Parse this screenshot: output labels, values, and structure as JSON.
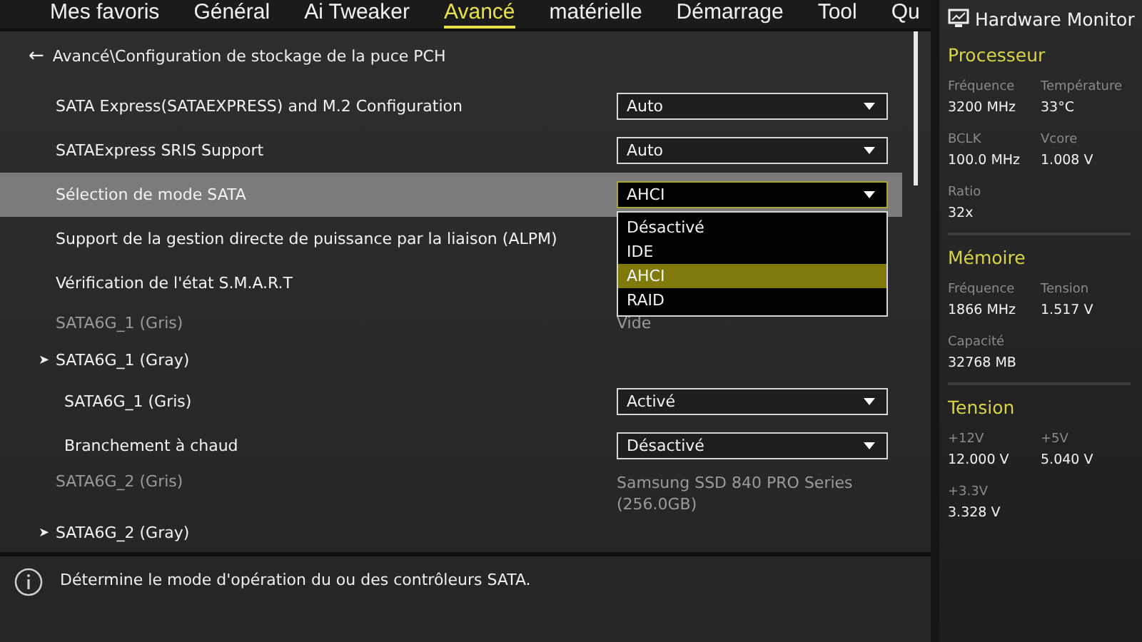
{
  "tabs": [
    {
      "label": "Mes favoris",
      "selected": false
    },
    {
      "label": "Général",
      "selected": false
    },
    {
      "label": "Ai Tweaker",
      "selected": false
    },
    {
      "label": "Avancé",
      "selected": true
    },
    {
      "label": "matérielle",
      "selected": false
    },
    {
      "label": "Démarrage",
      "selected": false
    },
    {
      "label": "Tool",
      "selected": false
    },
    {
      "label": "Qu",
      "selected": false
    }
  ],
  "breadcrumb": {
    "back": "←",
    "path": "Avancé\\Configuration de stockage de la puce PCH"
  },
  "settings": [
    {
      "kind": "dropdown",
      "label": "SATA Express(SATAEXPRESS) and M.2 Configuration",
      "value": "Auto",
      "selected": false
    },
    {
      "kind": "dropdown",
      "label": "SATAExpress SRIS Support",
      "value": "Auto",
      "selected": false
    },
    {
      "kind": "dropdown",
      "label": "Sélection de mode SATA",
      "value": "AHCI",
      "selected": true,
      "expanded": true,
      "options": [
        {
          "label": "Désactivé",
          "selected": false
        },
        {
          "label": "IDE",
          "selected": false
        },
        {
          "label": "AHCI",
          "selected": true
        },
        {
          "label": "RAID",
          "selected": false
        }
      ]
    },
    {
      "kind": "setting",
      "label": "Support de la gestion directe de puissance par la liaison (ALPM)",
      "selected": false
    },
    {
      "kind": "setting",
      "label": "Vérification de l'état S.M.A.R.T",
      "selected": false
    },
    {
      "kind": "info",
      "label": "SATA6G_1 (Gris)",
      "value": "Vide",
      "selected": false
    },
    {
      "kind": "group",
      "arrow": "➤",
      "label": "SATA6G_1 (Gray)",
      "selected": false,
      "children": [
        {
          "kind": "dropdown",
          "label": "SATA6G_1 (Gris)",
          "value": "Activé",
          "selected": false
        },
        {
          "kind": "dropdown",
          "label": "Branchement à chaud",
          "value": "Désactivé",
          "selected": false
        }
      ]
    },
    {
      "kind": "info",
      "label": "SATA6G_2 (Gris)",
      "value": "Samsung SSD 840 PRO Series (256.0GB)",
      "selected": false
    },
    {
      "kind": "group",
      "arrow": "➤",
      "label": "SATA6G_2 (Gray)",
      "selected": false
    }
  ],
  "help": {
    "text": "Détermine le mode d'opération du ou des contrôleurs SATA."
  },
  "hardware_monitor": {
    "title": "Hardware Monitor",
    "sections": [
      {
        "title": "Processeur",
        "items": [
          {
            "label": "Fréquence",
            "value": "3200 MHz"
          },
          {
            "label": "Température",
            "value": "33°C"
          },
          {
            "label": "BCLK",
            "value": "100.0 MHz"
          },
          {
            "label": "Vcore",
            "value": "1.008 V"
          },
          {
            "label": "Ratio",
            "value": "32x"
          }
        ]
      },
      {
        "title": "Mémoire",
        "items": [
          {
            "label": "Fréquence",
            "value": "1866 MHz"
          },
          {
            "label": "Tension",
            "value": "1.517 V"
          },
          {
            "label": "Capacité",
            "value": "32768 MB"
          }
        ]
      },
      {
        "title": "Tension",
        "items": [
          {
            "label": "+12V",
            "value": "12.000 V"
          },
          {
            "label": "+5V",
            "value": "5.040 V"
          },
          {
            "label": "+3.3V",
            "value": "3.328 V"
          }
        ]
      }
    ]
  }
}
